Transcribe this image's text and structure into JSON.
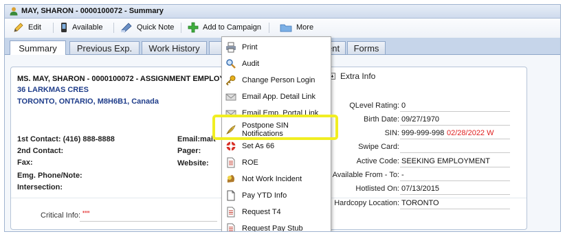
{
  "window": {
    "title": "MAY, SHARON - 0000100072 - Summary"
  },
  "toolbar": {
    "edit": "Edit",
    "available": "Available",
    "quick_note": "Quick Note",
    "add_to_campaign": "Add to Campaign",
    "more": "More"
  },
  "tabs": [
    {
      "label": "Summary",
      "active": true
    },
    {
      "label": "Previous Exp."
    },
    {
      "label": "Work History"
    },
    {
      "label": ""
    },
    {
      "label": "ent"
    },
    {
      "label": "Forms"
    }
  ],
  "summary": {
    "header": "MS. MAY, SHARON - 0000100072 - ASSIGNMENT EMPLOYE",
    "address1": "36 LARKMAS CRES",
    "address2": "TORONTO, ONTARIO, M8H6B1, Canada",
    "contact1": "1st Contact: (416) 888-8888",
    "contact2": "2nd Contact:",
    "fax": "Fax:",
    "emg": "Emg. Phone/Note:",
    "intersection": "Intersection:",
    "email": "Email:mait",
    "pager": "Pager:",
    "website": "Website:",
    "critical_label": "Critical Info:",
    "critical_value": "''''"
  },
  "extra_info": {
    "title": "Extra Info",
    "fields": [
      {
        "label": "QLevel Rating:",
        "value": "0"
      },
      {
        "label": "Birth Date:",
        "value": "09/27/1970"
      },
      {
        "label": "SIN:",
        "value": "999-999-998",
        "extra": "02/28/2022 W"
      },
      {
        "label": "Swipe Card:",
        "value": ""
      },
      {
        "label": "Active Code:",
        "value": "SEEKING EMPLOYMENT"
      },
      {
        "label": "Available From - To:",
        "value": "-"
      },
      {
        "label": "Hotlisted On:",
        "value": "07/13/2015"
      },
      {
        "label": "Hardcopy Location:",
        "value": "TORONTO"
      }
    ]
  },
  "more_menu": {
    "items": [
      {
        "label": "Print",
        "icon": "printer-icon"
      },
      {
        "label": "Audit",
        "icon": "magnifier-icon"
      },
      {
        "label": "Change Person Login",
        "icon": "key-icon"
      },
      {
        "label": "Email App. Detail Link",
        "icon": "envelope-icon"
      },
      {
        "label": "Email Emp. Portal Link",
        "icon": "envelope-icon"
      },
      {
        "label": "Postpone SIN Notifications",
        "icon": "feather-icon"
      },
      {
        "label": "Set As 66",
        "icon": "lifebuoy-icon"
      },
      {
        "label": "ROE",
        "icon": "document-icon"
      },
      {
        "label": "Not Work Incident",
        "icon": "hazard-icon"
      },
      {
        "label": "Pay YTD Info",
        "icon": "blank-page-icon"
      },
      {
        "label": "Request T4",
        "icon": "document-icon"
      },
      {
        "label": "Request Pay Stub",
        "icon": "document-icon"
      }
    ]
  },
  "colors": {
    "highlight": "#f1ee22",
    "sin_date": "#e02020",
    "link_blue": "#1f3d8a"
  }
}
